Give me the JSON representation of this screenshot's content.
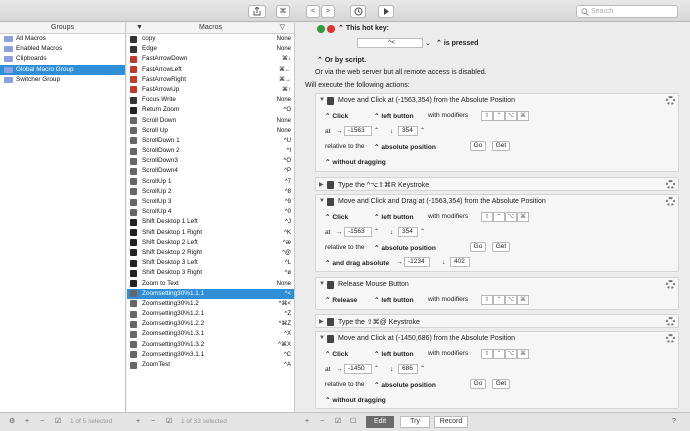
{
  "toolbar": {
    "search_placeholder": "Search"
  },
  "groups": {
    "header": "Groups",
    "items": [
      {
        "label": "All Macros"
      },
      {
        "label": "Enabled Macros"
      },
      {
        "label": "Clipboards"
      },
      {
        "label": "Global Macro Group",
        "selected": true
      },
      {
        "label": "Switcher Group"
      }
    ],
    "count": "1 of 5 selected"
  },
  "macros": {
    "header": "Macros",
    "items": [
      {
        "name": "copy",
        "hotkey": "None"
      },
      {
        "name": "Edge",
        "hotkey": "None"
      },
      {
        "name": "FastArrowDown",
        "hotkey": "⌘↓"
      },
      {
        "name": "FastArrowLeft",
        "hotkey": "⌘←"
      },
      {
        "name": "FastArrowRight",
        "hotkey": "⌘→"
      },
      {
        "name": "FastArrowUp",
        "hotkey": "⌘↑"
      },
      {
        "name": "Focus Write",
        "hotkey": "None"
      },
      {
        "name": "Return Zoom",
        "hotkey": "^O"
      },
      {
        "name": "Scroll Down",
        "hotkey": "None"
      },
      {
        "name": "Scroll Up",
        "hotkey": "None"
      },
      {
        "name": "ScrollDown 1",
        "hotkey": "^U"
      },
      {
        "name": "ScrollDown 2",
        "hotkey": "^I"
      },
      {
        "name": "ScrollDown3",
        "hotkey": "^O"
      },
      {
        "name": "ScrollDown4",
        "hotkey": "^P"
      },
      {
        "name": "ScrollUp 1",
        "hotkey": "^7"
      },
      {
        "name": "ScrollUp 2",
        "hotkey": "^8"
      },
      {
        "name": "ScrollUp 3",
        "hotkey": "^9"
      },
      {
        "name": "ScrollUp 4",
        "hotkey": "^0"
      },
      {
        "name": "Shift Desktop 1 Left",
        "hotkey": "^J"
      },
      {
        "name": "Shift Desktop 1 Right",
        "hotkey": "^K"
      },
      {
        "name": "Shift Desktop 2 Left",
        "hotkey": "^æ"
      },
      {
        "name": "Shift Desktop 2 Right",
        "hotkey": "^@"
      },
      {
        "name": "Shift Desktop 3 Left",
        "hotkey": "^L"
      },
      {
        "name": "Shift Desktop 3 Right",
        "hotkey": "^ø"
      },
      {
        "name": "Zoom to Text",
        "hotkey": "None"
      },
      {
        "name": "Zoomsetting30%1.1.1",
        "hotkey": "^<",
        "selected": true
      },
      {
        "name": "Zoomsetting30%1.2",
        "hotkey": "^⌘<"
      },
      {
        "name": "Zoomsetting30%1.2.1",
        "hotkey": "^Z"
      },
      {
        "name": "Zoomsetting30%1.2.2",
        "hotkey": "^⌘Z"
      },
      {
        "name": "Zoomsetting30%1.3.1",
        "hotkey": "^X"
      },
      {
        "name": "Zoomsetting30%1.3.2",
        "hotkey": "^⌘X"
      },
      {
        "name": "Zoomsetting30%3.1.1",
        "hotkey": "^C"
      },
      {
        "name": "ZoomTest",
        "hotkey": "^A"
      }
    ],
    "count": "1 of 33 selected"
  },
  "trigger": {
    "this_hot_key": "This hot key:",
    "key_value": "^<",
    "is_pressed": "is pressed",
    "or_by_script": "Or by script.",
    "web_server": "Or via the web server but all remote access is disabled.",
    "will_execute": "Will execute the following actions:"
  },
  "actions": [
    {
      "title": "Move and Click at (-1563,354) from the Absolute Position",
      "click": "Click",
      "button": "left button",
      "with_modifiers": "with modifiers",
      "at": "at",
      "x": "-1563",
      "y": "354",
      "relative_to": "relative to the",
      "position": "absolute position",
      "go": "Go",
      "get": "Get",
      "drag": "without dragging"
    },
    {
      "title": "Type the ^⌥⇧⌘R Keystroke"
    },
    {
      "title": "Move and Click and Drag at (-1563,354) from the Absolute Position",
      "click": "Click",
      "button": "left button",
      "with_modifiers": "with modifiers",
      "at": "at",
      "x": "-1563",
      "y": "354",
      "relative_to": "relative to the",
      "position": "absolute position",
      "go": "Go",
      "get": "Get",
      "drag": "and drag absolute",
      "drag_x": "-1234",
      "drag_y": "402"
    },
    {
      "title": "Release Mouse Button",
      "click": "Release",
      "button": "left button",
      "with_modifiers": "with modifiers"
    },
    {
      "title": "Type the ⇧⌘@ Keystroke"
    },
    {
      "title": "Move and Click at (-1450,686) from the Absolute Position",
      "click": "Click",
      "button": "left button",
      "with_modifiers": "with modifiers",
      "at": "at",
      "x": "-1450",
      "y": "686",
      "relative_to": "relative to the",
      "position": "absolute position",
      "go": "Go",
      "get": "Get",
      "drag": "without dragging"
    }
  ],
  "bottom": {
    "edit": "Edit",
    "try": "Try",
    "record": "Record",
    "help": "?"
  }
}
